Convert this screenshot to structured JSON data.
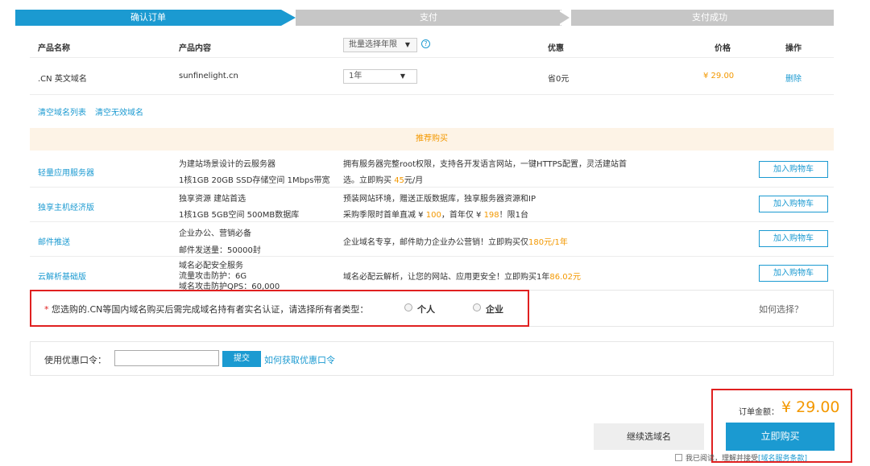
{
  "steps": {
    "step1": "确认订单",
    "step2": "支付",
    "step3": "支付成功"
  },
  "table": {
    "headers": {
      "name": "产品名称",
      "content": "产品内容",
      "years_select": "批量选择年限",
      "discount": "优惠",
      "price": "价格",
      "action": "操作"
    },
    "row": {
      "name": ".CN 英文域名",
      "domain": "sunfinelight.cn",
      "years": "1年",
      "discount": "省0元",
      "price": "¥ 29.00",
      "delete": "删除"
    }
  },
  "links": {
    "clear_list": "清空域名列表",
    "clear_invalid": "清空无效域名"
  },
  "promo": {
    "header": "推荐购买",
    "add_to_cart": "加入购物车",
    "items": [
      {
        "name": "轻量应用服务器",
        "desc1": "为建站场景设计的云服务器",
        "desc2": "1核1GB 20GB SSD存储空间 1Mbps带宽",
        "info1": "拥有服务器完整root权限，支持各开发语言网站，一键HTTPS配置，灵活建站首",
        "info2_pre": "选。立即购买 ",
        "info2_hl": "45",
        "info2_post": "元/月"
      },
      {
        "name": "独享主机经济版",
        "desc1": "独享资源 建站首选",
        "desc2": "1核1GB 5GB空间 500MB数据库",
        "info1": "预装网站环境，赠送正版数据库，独享服务器资源和IP",
        "info2_pre": "采购季限时首单直减 ¥ ",
        "info2_hl": "100",
        "info2_mid": "，首年仅 ¥ ",
        "info2_hl2": "198",
        "info2_post": "！限1台"
      },
      {
        "name": "邮件推送",
        "desc1": "企业办公、营销必备",
        "desc2": "邮件发送量：50000封",
        "info1_pre": "企业域名专享，邮件助力企业办公营销！立即购买仅",
        "info1_hl": "180元/1年"
      },
      {
        "name": "云解析基础版",
        "desc1": "域名必配安全服务",
        "desc2": "流量攻击防护：6G",
        "desc3": "域名攻击防护QPS：60,000",
        "info1_pre": "域名必配云解析，让您的网站、应用更安全！立即购买1年",
        "info1_hl": "86.02元"
      }
    ]
  },
  "verify": {
    "asterisk": "*",
    "text": "您选购的.CN等国内域名购买后需完成域名持有者实名认证，请选择所有者类型：",
    "opt_person": "个人",
    "opt_company": "企业",
    "how": "如何选择？"
  },
  "coupon": {
    "label": "使用优惠口令：",
    "value": "",
    "submit": "提交",
    "how": "如何获取优惠口令"
  },
  "order": {
    "total_label": "订单金额：",
    "total": "¥ 29.00",
    "continue": "继续选域名",
    "buy": "立即购买",
    "agree_pre": "我已阅读，理解并接受",
    "agree_link": "[域名服务条款]"
  },
  "colors": {
    "accent": "#1b9ad1",
    "orange": "#f39800",
    "red_box": "#e02020"
  }
}
